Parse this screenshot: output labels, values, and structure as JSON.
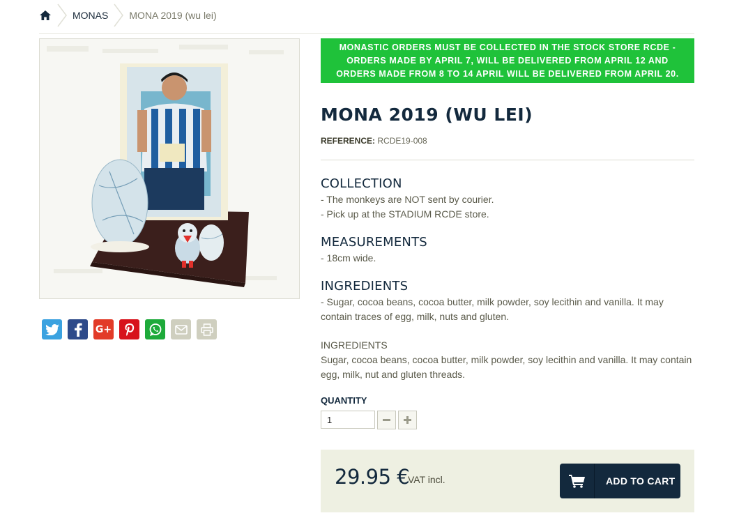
{
  "colors": {
    "brand_navy": "#13293d",
    "notice_green": "#1fc23a",
    "price_box_bg": "#eef0e2"
  },
  "breadcrumb": {
    "home_icon": "home-icon",
    "items": [
      {
        "label": "MONAS"
      }
    ],
    "current": "MONA 2019 (wu lei)"
  },
  "notice": "MONASTIC ORDERS MUST BE COLLECTED IN THE STOCK STORE RCDE - ORDERS MADE BY APRIL 7, WILL BE DELIVERED FROM APRIL 12 AND ORDERS MADE FROM 8 TO 14 APRIL WILL BE DELIVERED FROM APRIL 20.",
  "product": {
    "title": "MONA 2019 (WU LEI)",
    "reference_label": "REFERENCE:",
    "reference_value": "RCDE19-008"
  },
  "sections": {
    "collection": {
      "heading": "COLLECTION",
      "lines": [
        "- The monkeys are NOT sent by courier.",
        "- Pick up at the STADIUM RCDE store."
      ]
    },
    "measurements": {
      "heading": "MEASUREMENTS",
      "lines": [
        "- 18cm wide."
      ]
    },
    "ingredients": {
      "heading": "INGREDIENTS",
      "lines": [
        "- Sugar, cocoa beans, cocoa butter, milk powder, soy lecithin and vanilla. It may contain traces of egg, milk, nuts and gluten."
      ]
    },
    "ingredients_alt": {
      "heading": "INGREDIENTS",
      "lines": [
        "Sugar, cocoa beans, cocoa butter, milk powder, soy lecithin and vanilla. It may contain egg, milk, nut and gluten threads."
      ]
    }
  },
  "quantity": {
    "label": "QUANTITY",
    "value": "1"
  },
  "price": {
    "amount": "29.95 €",
    "vat": "VAT incl."
  },
  "cart": {
    "label": "ADD TO CART",
    "icon": "cart-icon"
  },
  "share": [
    {
      "icon": "twitter-icon",
      "glyph": "",
      "color": "#3ba2e0"
    },
    {
      "icon": "facebook-icon",
      "glyph": "f",
      "color": "#2d4a8a"
    },
    {
      "icon": "google-plus-icon",
      "glyph": "G+",
      "color": "#e23b28"
    },
    {
      "icon": "pinterest-icon",
      "glyph": "P",
      "color": "#d7121b"
    },
    {
      "icon": "whatsapp-icon",
      "glyph": "",
      "color": "#1eaa3a"
    },
    {
      "icon": "email-icon",
      "glyph": "",
      "color": "#cfcfbf"
    },
    {
      "icon": "print-icon",
      "glyph": "",
      "color": "#cfcfbf"
    }
  ]
}
